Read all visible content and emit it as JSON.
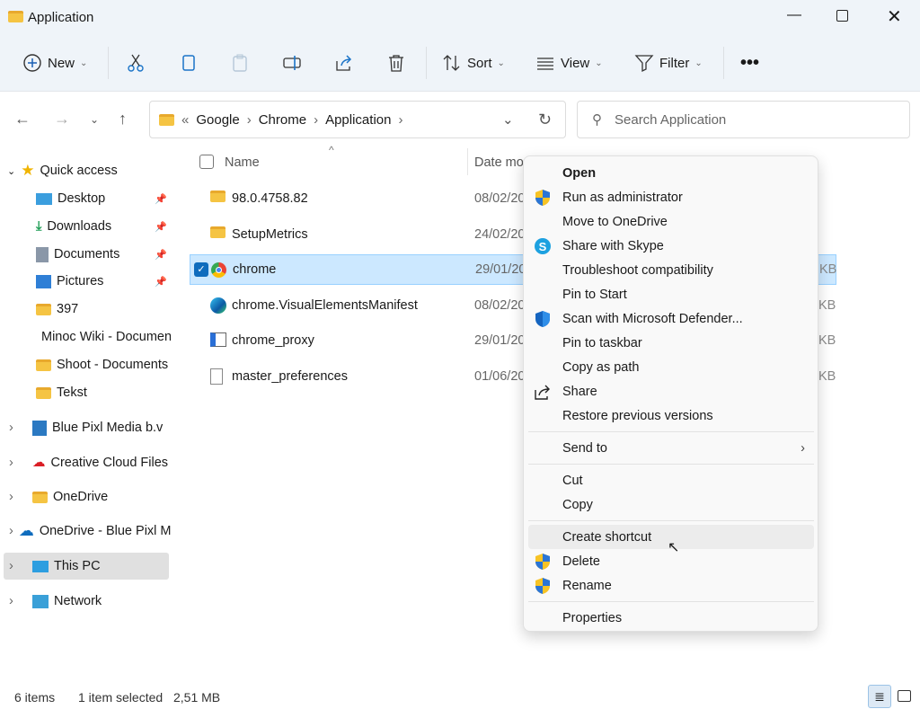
{
  "window": {
    "title": "Application",
    "controls": [
      "minimize",
      "maximize",
      "close"
    ]
  },
  "toolbar": {
    "new_label": "New",
    "sort_label": "Sort",
    "view_label": "View",
    "filter_label": "Filter",
    "icons": [
      "cut-icon",
      "copy-icon",
      "paste-icon",
      "rename-icon",
      "share-icon",
      "delete-icon"
    ]
  },
  "address": {
    "breadcrumb": [
      "Google",
      "Chrome",
      "Application"
    ],
    "overflow": "«"
  },
  "search": {
    "placeholder": "Search Application"
  },
  "sidebar": {
    "quick_access": "Quick access",
    "pinned": [
      {
        "label": "Desktop"
      },
      {
        "label": "Downloads"
      },
      {
        "label": "Documents"
      },
      {
        "label": "Pictures"
      }
    ],
    "folders": [
      {
        "label": "397"
      },
      {
        "label": "Minoc Wiki - Documents"
      },
      {
        "label": "Shoot - Documents"
      },
      {
        "label": "Tekst"
      }
    ],
    "roots": [
      {
        "label": "Blue Pixl Media b.v"
      },
      {
        "label": "Creative Cloud Files"
      },
      {
        "label": "OneDrive"
      },
      {
        "label": "OneDrive - Blue Pixl Media"
      },
      {
        "label": "This PC"
      },
      {
        "label": "Network"
      }
    ]
  },
  "columns": {
    "name": "Name",
    "date": "Date modified"
  },
  "files": [
    {
      "name": "98.0.4758.82",
      "date": "08/02/20",
      "size": "",
      "type": "folder"
    },
    {
      "name": "SetupMetrics",
      "date": "24/02/20",
      "size": "",
      "type": "folder"
    },
    {
      "name": "chrome",
      "date": "29/01/20",
      "size": "KB",
      "type": "chrome",
      "selected": true
    },
    {
      "name": "chrome.VisualElementsManifest",
      "date": "08/02/20",
      "size": "KB",
      "type": "edge"
    },
    {
      "name": "chrome_proxy",
      "date": "29/01/20",
      "size": "KB",
      "type": "exe"
    },
    {
      "name": "master_preferences",
      "date": "01/06/20",
      "size": "KB",
      "type": "file"
    }
  ],
  "context_menu": {
    "group1": [
      {
        "label": "Open",
        "icon": "",
        "bold": true
      },
      {
        "label": "Run as administrator",
        "icon": "uac-shield-icon"
      },
      {
        "label": "Move to OneDrive",
        "icon": ""
      },
      {
        "label": "Share with Skype",
        "icon": "skype-icon"
      },
      {
        "label": "Troubleshoot compatibility",
        "icon": ""
      },
      {
        "label": "Pin to Start",
        "icon": ""
      },
      {
        "label": "Scan with Microsoft Defender...",
        "icon": "defender-icon"
      },
      {
        "label": "Pin to taskbar",
        "icon": ""
      },
      {
        "label": "Copy as path",
        "icon": ""
      },
      {
        "label": "Share",
        "icon": "share-icon"
      },
      {
        "label": "Restore previous versions",
        "icon": ""
      }
    ],
    "send_to": "Send to",
    "cut": "Cut",
    "copy": "Copy",
    "create_shortcut": "Create shortcut",
    "delete": "Delete",
    "rename": "Rename",
    "properties": "Properties"
  },
  "status": {
    "items": "6 items",
    "selected": "1 item selected",
    "size": "2,51 MB"
  }
}
